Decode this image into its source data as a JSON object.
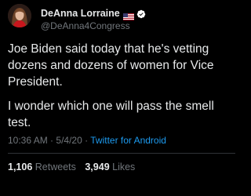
{
  "author": {
    "display_name": "DeAnna Lorraine",
    "handle": "@DeAnna4Congress",
    "flag_icon": "us-flag-icon",
    "verified_icon": "verified-badge-icon",
    "verified_color": "#1d9bf0"
  },
  "tweet": {
    "paragraphs": [
      "Joe Biden said today that he's vetting dozens and dozens of women for Vice President.",
      "I wonder which one will pass the smell test."
    ],
    "time": "10:36 AM",
    "date": "5/4/20",
    "source": "Twitter for Android"
  },
  "stats": {
    "retweets_count": "1,106",
    "retweets_label": "Retweets",
    "likes_count": "3,949",
    "likes_label": "Likes"
  },
  "colors": {
    "background": "#000000",
    "text": "#e7e9ea",
    "secondary": "#71767b",
    "link": "#1d9bf0"
  }
}
